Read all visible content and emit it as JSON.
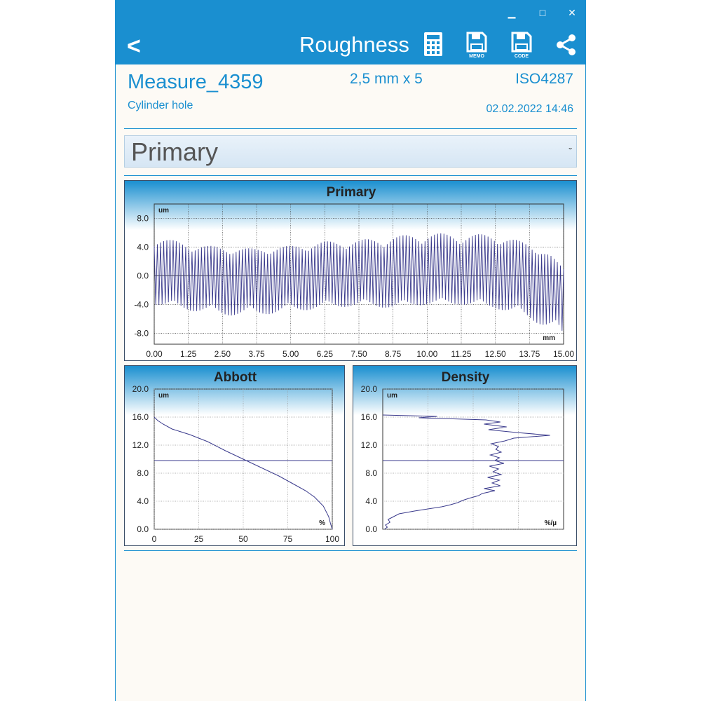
{
  "window": {
    "minimize": "▁",
    "maximize": "□",
    "close": "✕"
  },
  "toolbar": {
    "back": "<",
    "title": "Roughness",
    "icons": [
      {
        "name": "calculator-icon",
        "label": ""
      },
      {
        "name": "save-memo-icon",
        "label": "MEMO"
      },
      {
        "name": "save-code-icon",
        "label": "CODE"
      },
      {
        "name": "share-icon",
        "label": ""
      }
    ]
  },
  "measurement": {
    "name": "Measure_4359",
    "description": "Cylinder hole",
    "length": "2,5 mm x 5",
    "standard": "ISO4287",
    "date": "02.02.2022  14:46"
  },
  "profile_select": {
    "value": "Primary"
  },
  "colors": {
    "accent": "#1a8fd0",
    "trace": "#3a3a8c",
    "bg": "#fdfaf5"
  },
  "chart_data": [
    {
      "type": "line",
      "title": "Primary",
      "ylabel": "um",
      "xlabel": "mm",
      "xlim": [
        0,
        15
      ],
      "ylim": [
        -9.5,
        10
      ],
      "xticks": [
        "0.00",
        "1.25",
        "2.50",
        "3.75",
        "5.00",
        "6.25",
        "7.50",
        "8.75",
        "10.00",
        "11.25",
        "12.50",
        "13.75",
        "15.00"
      ],
      "yticks": [
        "8.0",
        "4.0",
        "0.0",
        "-4.0",
        "-8.0"
      ],
      "grid": true,
      "series": [
        {
          "envelope_x": [
            0,
            1.25,
            2.5,
            3.75,
            5.0,
            6.25,
            7.5,
            8.75,
            10.0,
            11.25,
            12.5,
            13.75,
            14.5,
            15.0
          ],
          "upper": [
            5.5,
            4.5,
            4.0,
            3.8,
            4.2,
            4.8,
            5.0,
            5.5,
            6.0,
            5.8,
            5.8,
            4.5,
            3.0,
            1.0
          ],
          "lower": [
            -4.0,
            -4.8,
            -5.5,
            -5.5,
            -5.0,
            -4.5,
            -4.2,
            -4.5,
            -4.0,
            -4.0,
            -4.5,
            -6.0,
            -7.5,
            -9.0
          ]
        }
      ]
    },
    {
      "type": "line",
      "title": "Abbott",
      "ylabel": "um",
      "xlabel": "%",
      "xlim": [
        0,
        100
      ],
      "ylim": [
        0,
        20
      ],
      "xticks": [
        "0",
        "25",
        "50",
        "75",
        "100"
      ],
      "yticks": [
        "20.0",
        "16.0",
        "12.0",
        "8.0",
        "4.0",
        "0.0"
      ],
      "grid": true,
      "x": [
        0,
        2,
        5,
        10,
        20,
        30,
        40,
        50,
        60,
        70,
        80,
        85,
        90,
        95,
        98,
        99,
        100
      ],
      "y": [
        16.0,
        15.5,
        15.0,
        14.3,
        13.5,
        12.5,
        11.2,
        10.0,
        8.8,
        7.6,
        6.2,
        5.5,
        4.6,
        3.3,
        1.8,
        0.8,
        0.0
      ],
      "reference_line": 9.8
    },
    {
      "type": "line",
      "title": "Density",
      "ylabel": "um",
      "xlabel": "%/µ",
      "ylim": [
        0,
        20
      ],
      "yticks": [
        "20.0",
        "16.0",
        "12.0",
        "8.0",
        "4.0",
        "0.0"
      ],
      "grid": true,
      "y": [
        0.0,
        0.3,
        0.6,
        1.0,
        1.4,
        1.8,
        2.2,
        2.6,
        2.9,
        3.2,
        3.5,
        3.8,
        4.1,
        4.4,
        4.8,
        5.1,
        5.5,
        5.8,
        6.2,
        6.6,
        7.0,
        7.4,
        7.8,
        8.2,
        8.6,
        9.0,
        9.4,
        9.8,
        10.2,
        10.6,
        11.0,
        11.4,
        11.8,
        12.2,
        12.6,
        13.0,
        13.4,
        13.8,
        14.2,
        14.6,
        15.0,
        15.3,
        15.6,
        15.9,
        16.1,
        16.3
      ],
      "x": [
        0.2,
        0.5,
        0.3,
        0.8,
        0.6,
        1.2,
        1.8,
        3.5,
        5.0,
        6.5,
        7.5,
        8.3,
        8.8,
        9.5,
        10.6,
        11.0,
        12.4,
        11.2,
        13.0,
        12.1,
        12.9,
        11.6,
        13.1,
        12.2,
        12.8,
        11.8,
        13.4,
        12.4,
        12.9,
        11.9,
        13.1,
        12.5,
        12.8,
        12.0,
        13.5,
        14.5,
        18.5,
        14.8,
        11.7,
        13.7,
        11.2,
        13.0,
        11.4,
        4.0,
        6.0,
        0.0
      ],
      "reference_line": 9.8
    }
  ]
}
